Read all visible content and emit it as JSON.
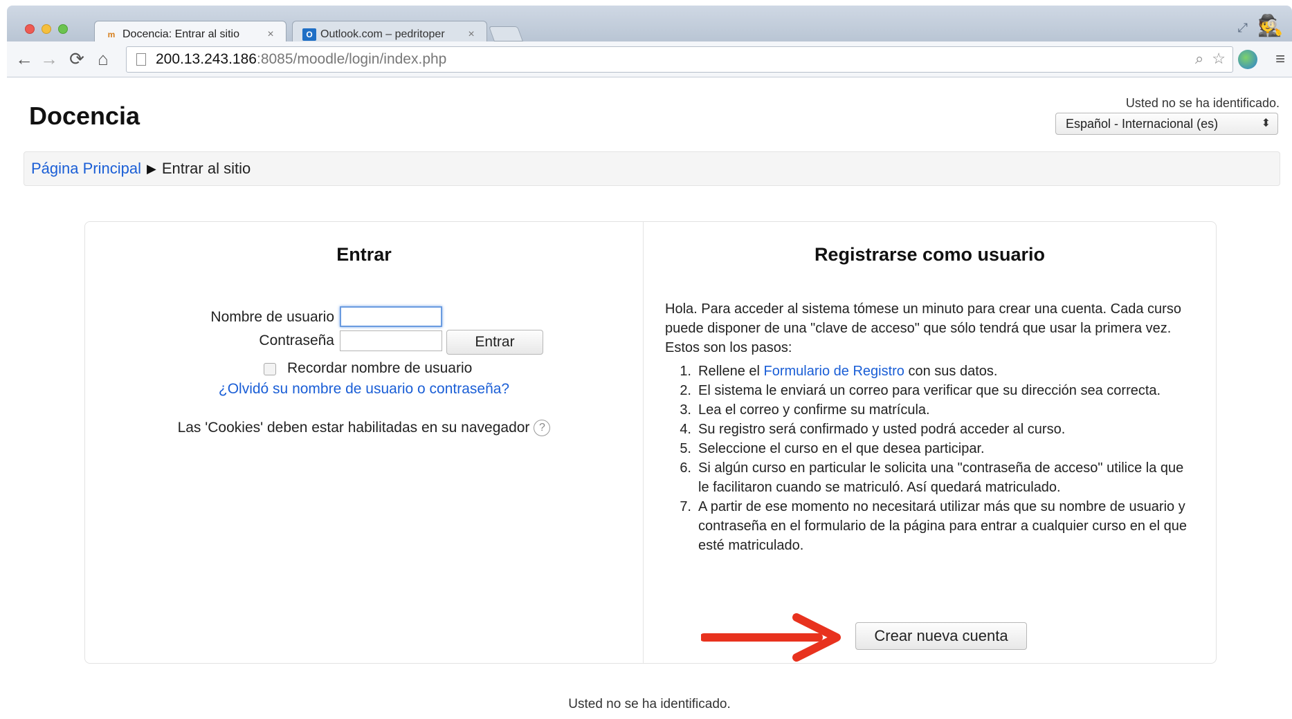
{
  "browser": {
    "tabs": [
      {
        "favicon": "moodle-favicon",
        "title": "Docencia: Entrar al sitio",
        "close": "×",
        "active": true
      },
      {
        "favicon": "outlook-favicon",
        "title": "Outlook.com – pedritoper",
        "close": "×",
        "active": false
      }
    ],
    "url_host": "200.13.243.186",
    "url_rest": ":8085/moodle/login/index.php"
  },
  "header": {
    "site_title": "Docencia",
    "login_info": "Usted no se ha identificado.",
    "language_selected": "Español - Internacional (es)"
  },
  "breadcrumb": {
    "home": "Página Principal",
    "current": "Entrar al sitio"
  },
  "login": {
    "heading": "Entrar",
    "username_label": "Nombre de usuario",
    "username_value": "",
    "password_label": "Contraseña",
    "password_value": "",
    "submit_label": "Entrar",
    "remember_label": "Recordar nombre de usuario",
    "remember_checked": false,
    "forgot_link": "¿Olvidó su nombre de usuario o contraseña?",
    "cookies_note": "Las 'Cookies' deben estar habilitadas en su navegador"
  },
  "signup": {
    "heading": "Registrarse como usuario",
    "intro": "Hola. Para acceder al sistema tómese un minuto para crear una cuenta. Cada curso puede disponer de una \"clave de acceso\" que sólo tendrá que usar la primera vez. Estos son los pasos:",
    "steps": [
      {
        "num": "1.",
        "before": "Rellene el ",
        "link": "Formulario de Registro",
        "after": " con sus datos."
      },
      {
        "num": "2.",
        "text": "El sistema le enviará un correo para verificar que su dirección sea correcta."
      },
      {
        "num": "3.",
        "text": "Lea el correo y confirme su matrícula."
      },
      {
        "num": "4.",
        "text": "Su registro será confirmado y usted podrá acceder al curso."
      },
      {
        "num": "5.",
        "text": "Seleccione el curso en el que desea participar."
      },
      {
        "num": "6.",
        "text": "Si algún curso en particular le solicita una \"contraseña de acceso\" utilice la que le facilitaron cuando se matriculó. Así quedará matriculado."
      },
      {
        "num": "7.",
        "text": "A partir de ese momento no necesitará utilizar más que su nombre de usuario y contraseña en el formulario de la página para entrar a cualquier curso en el que esté matriculado."
      }
    ],
    "create_button": "Crear nueva cuenta"
  },
  "footer": {
    "login_info": "Usted no se ha identificado."
  },
  "colors": {
    "link": "#1a5ed6",
    "annotation_arrow": "#e8321e"
  }
}
